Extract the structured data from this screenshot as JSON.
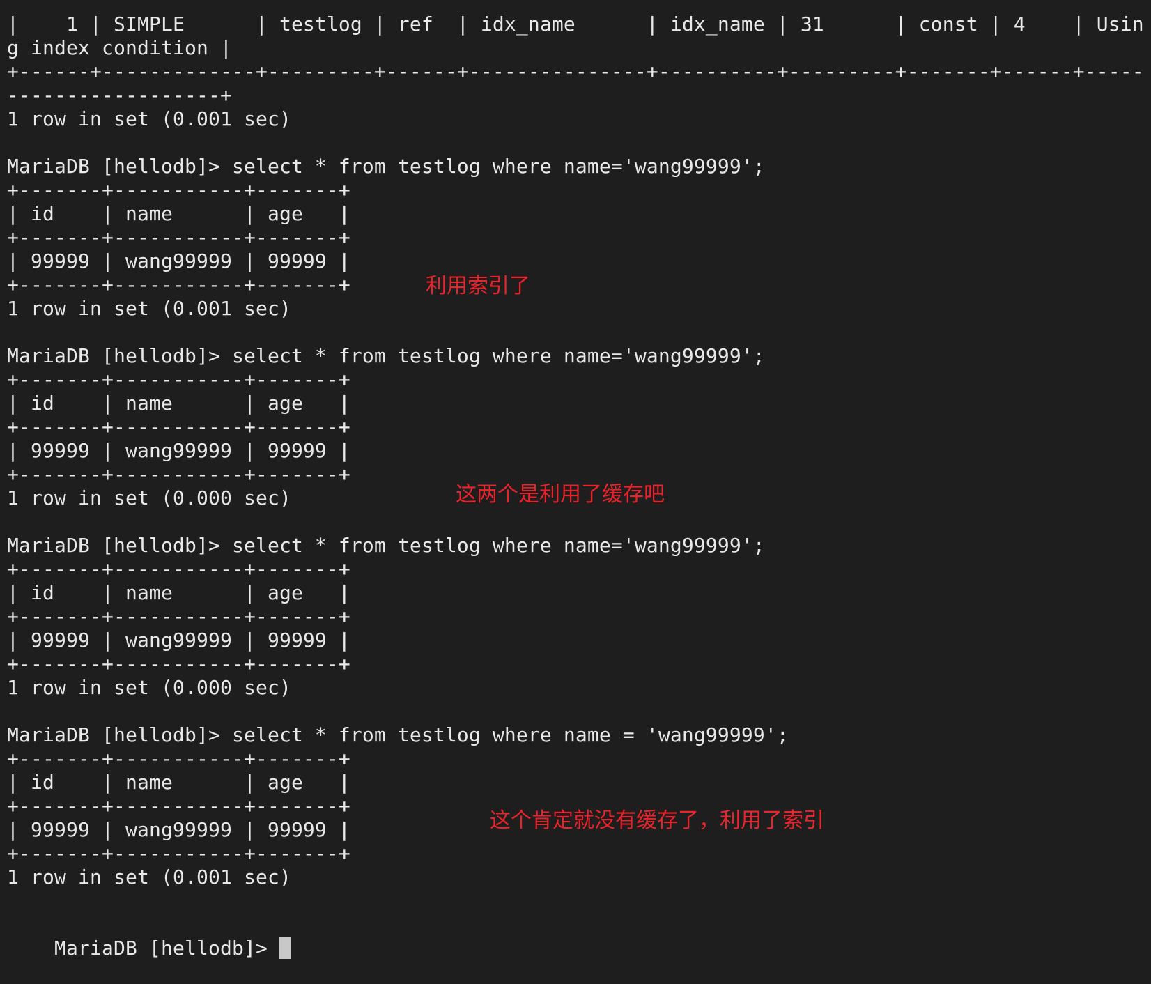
{
  "terminal": {
    "lines": [
      "|    1 | SIMPLE      | testlog | ref  | idx_name      | idx_name | 31      | const | 4    | Usin",
      "g index condition |",
      "+------+-------------+---------+------+---------------+----------+---------+-------+------+-----",
      "------------------+",
      "1 row in set (0.001 sec)",
      "",
      "MariaDB [hellodb]> select * from testlog where name='wang99999';",
      "+-------+-----------+-------+",
      "| id    | name      | age   |",
      "+-------+-----------+-------+",
      "| 99999 | wang99999 | 99999 |",
      "+-------+-----------+-------+",
      "1 row in set (0.001 sec)",
      "",
      "MariaDB [hellodb]> select * from testlog where name='wang99999';",
      "+-------+-----------+-------+",
      "| id    | name      | age   |",
      "+-------+-----------+-------+",
      "| 99999 | wang99999 | 99999 |",
      "+-------+-----------+-------+",
      "1 row in set (0.000 sec)",
      "",
      "MariaDB [hellodb]> select * from testlog where name='wang99999';",
      "+-------+-----------+-------+",
      "| id    | name      | age   |",
      "+-------+-----------+-------+",
      "| 99999 | wang99999 | 99999 |",
      "+-------+-----------+-------+",
      "1 row in set (0.000 sec)",
      "",
      "MariaDB [hellodb]> select * from testlog where name = 'wang99999';",
      "+-------+-----------+-------+",
      "| id    | name      | age   |",
      "+-------+-----------+-------+",
      "| 99999 | wang99999 | 99999 |",
      "+-------+-----------+-------+",
      "1 row in set (0.001 sec)",
      ""
    ],
    "prompt": "MariaDB [hellodb]> "
  },
  "annotations": [
    "利用索引了",
    "这两个是利用了缓存吧",
    "这个肯定就没有缓存了，利用了索引"
  ],
  "colors": {
    "background": "#1e1e1e",
    "text": "#e8e8e8",
    "annotation": "#e8232b",
    "cursor": "#c8c8c8"
  }
}
